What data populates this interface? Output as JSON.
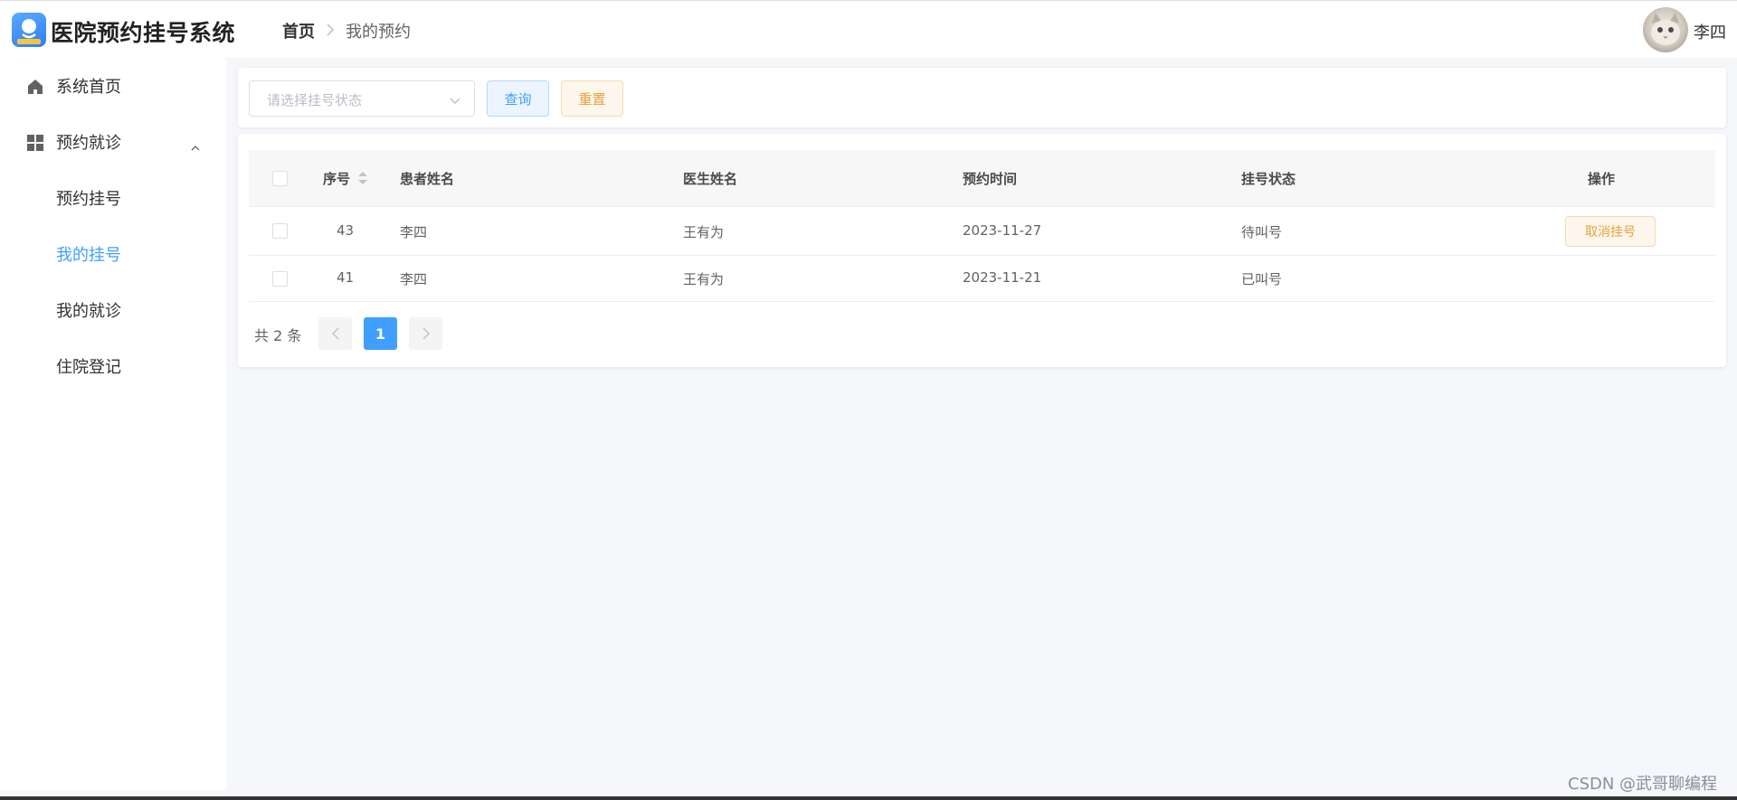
{
  "header": {
    "app_title": "医院预约挂号系统",
    "logo_text": "预约挂号",
    "breadcrumb": {
      "home": "首页",
      "current": "我的预约"
    },
    "user_name": "李四"
  },
  "sidebar": {
    "items": [
      {
        "label": "系统首页",
        "icon": "home-icon"
      },
      {
        "label": "预约就诊",
        "icon": "grid-icon",
        "expanded": true
      }
    ],
    "sub_items": [
      {
        "label": "预约挂号"
      },
      {
        "label": "我的挂号",
        "active": true
      },
      {
        "label": "我的就诊"
      },
      {
        "label": "住院登记"
      }
    ]
  },
  "search": {
    "status_placeholder": "请选择挂号状态",
    "query_label": "查询",
    "reset_label": "重置"
  },
  "table": {
    "columns": {
      "index": "序号",
      "patient": "患者姓名",
      "doctor": "医生姓名",
      "time": "预约时间",
      "status": "挂号状态",
      "action": "操作"
    },
    "rows": [
      {
        "index": "43",
        "patient": "李四",
        "doctor": "王有为",
        "time": "2023-11-27",
        "status": "待叫号",
        "action": "取消挂号"
      },
      {
        "index": "41",
        "patient": "李四",
        "doctor": "王有为",
        "time": "2023-11-21",
        "status": "已叫号",
        "action": ""
      }
    ]
  },
  "pagination": {
    "total": "共 2 条",
    "current_page": "1"
  },
  "watermark": "CSDN @武哥聊编程",
  "colors": {
    "primary": "#409eff",
    "warning": "#e6a23c",
    "background": "#f5f7fb"
  }
}
